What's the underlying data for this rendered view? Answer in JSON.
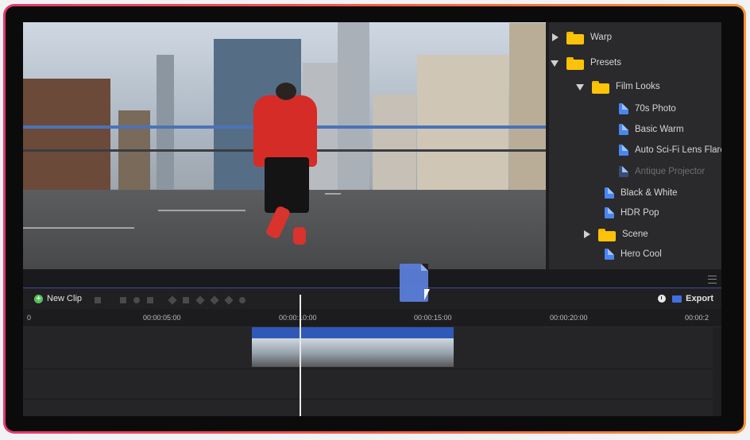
{
  "browser": {
    "items": [
      {
        "label": "Warp",
        "kind": "folder",
        "expanded": false
      },
      {
        "label": "Presets",
        "kind": "folder",
        "expanded": true
      },
      {
        "label": "Film Looks",
        "kind": "folder",
        "expanded": true
      },
      {
        "label": "70s Photo",
        "kind": "preset"
      },
      {
        "label": "Basic Warm",
        "kind": "preset"
      },
      {
        "label": "Auto Sci-Fi Lens Flares",
        "kind": "preset"
      },
      {
        "label": "Antique Projector",
        "kind": "preset",
        "dimmed": true
      },
      {
        "label": "Black & White",
        "kind": "preset"
      },
      {
        "label": "HDR Pop",
        "kind": "preset"
      },
      {
        "label": "Scene",
        "kind": "folder",
        "expanded": false
      },
      {
        "label": "Hero Cool",
        "kind": "preset"
      }
    ]
  },
  "toolbar": {
    "new_clip_label": "New Clip",
    "export_label": "Export"
  },
  "timeline": {
    "ticks": [
      "0",
      "00:00:05:00",
      "00:00:10:00",
      "00:00:15:00",
      "00:00:20:00",
      "00:00:2"
    ]
  },
  "colors": {
    "accent": "#3f6fe0",
    "folder": "#fdc308",
    "preset_icon": "#4a86f0",
    "frame_gradient": [
      "#e23a6e",
      "#f79334"
    ]
  }
}
